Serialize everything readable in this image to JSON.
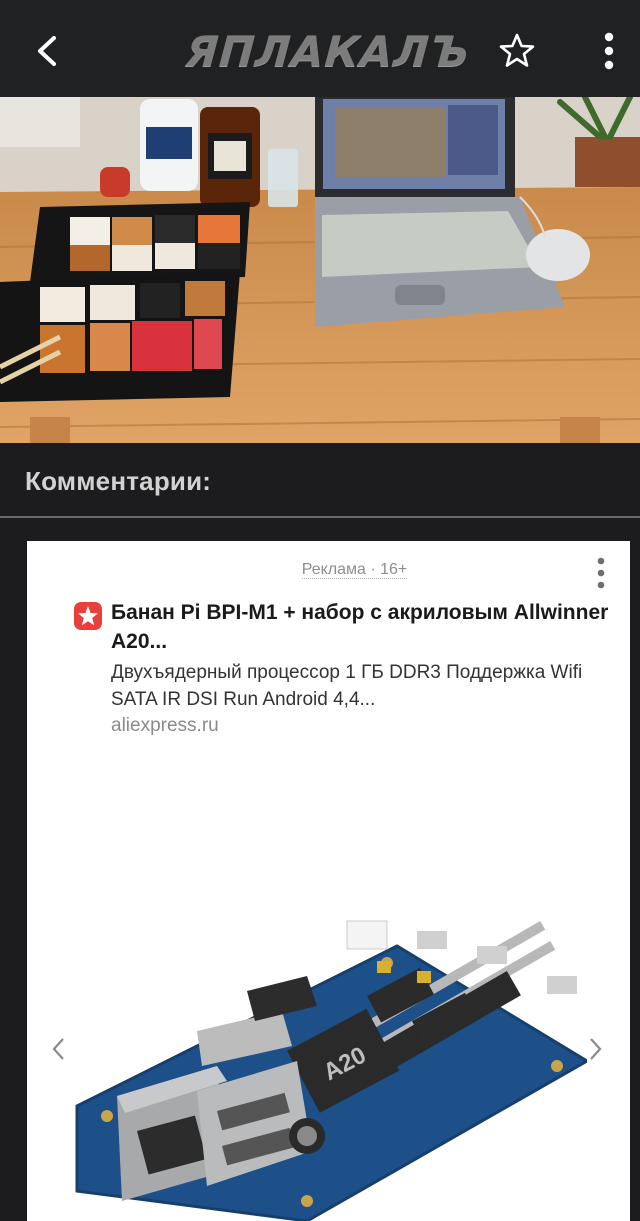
{
  "header": {
    "logo_text": "ЯПЛАКАЛЪ",
    "icons": [
      "back-arrow-icon",
      "star-icon",
      "more-vert-icon"
    ]
  },
  "comments": {
    "title": "Комментарии:"
  },
  "ad": {
    "label": "Реклама · 16+",
    "title": "Банан Pi BPI-M1 + набор с акриловым Allwinner A20...",
    "description": "Двухъядерный процессор 1 ГБ DDR3 Поддержка Wifi SATA IR DSI Run Android 4,4...",
    "domain": "aliexpress.ru",
    "brand_color": "#e8403a",
    "chip_label": "A20"
  }
}
